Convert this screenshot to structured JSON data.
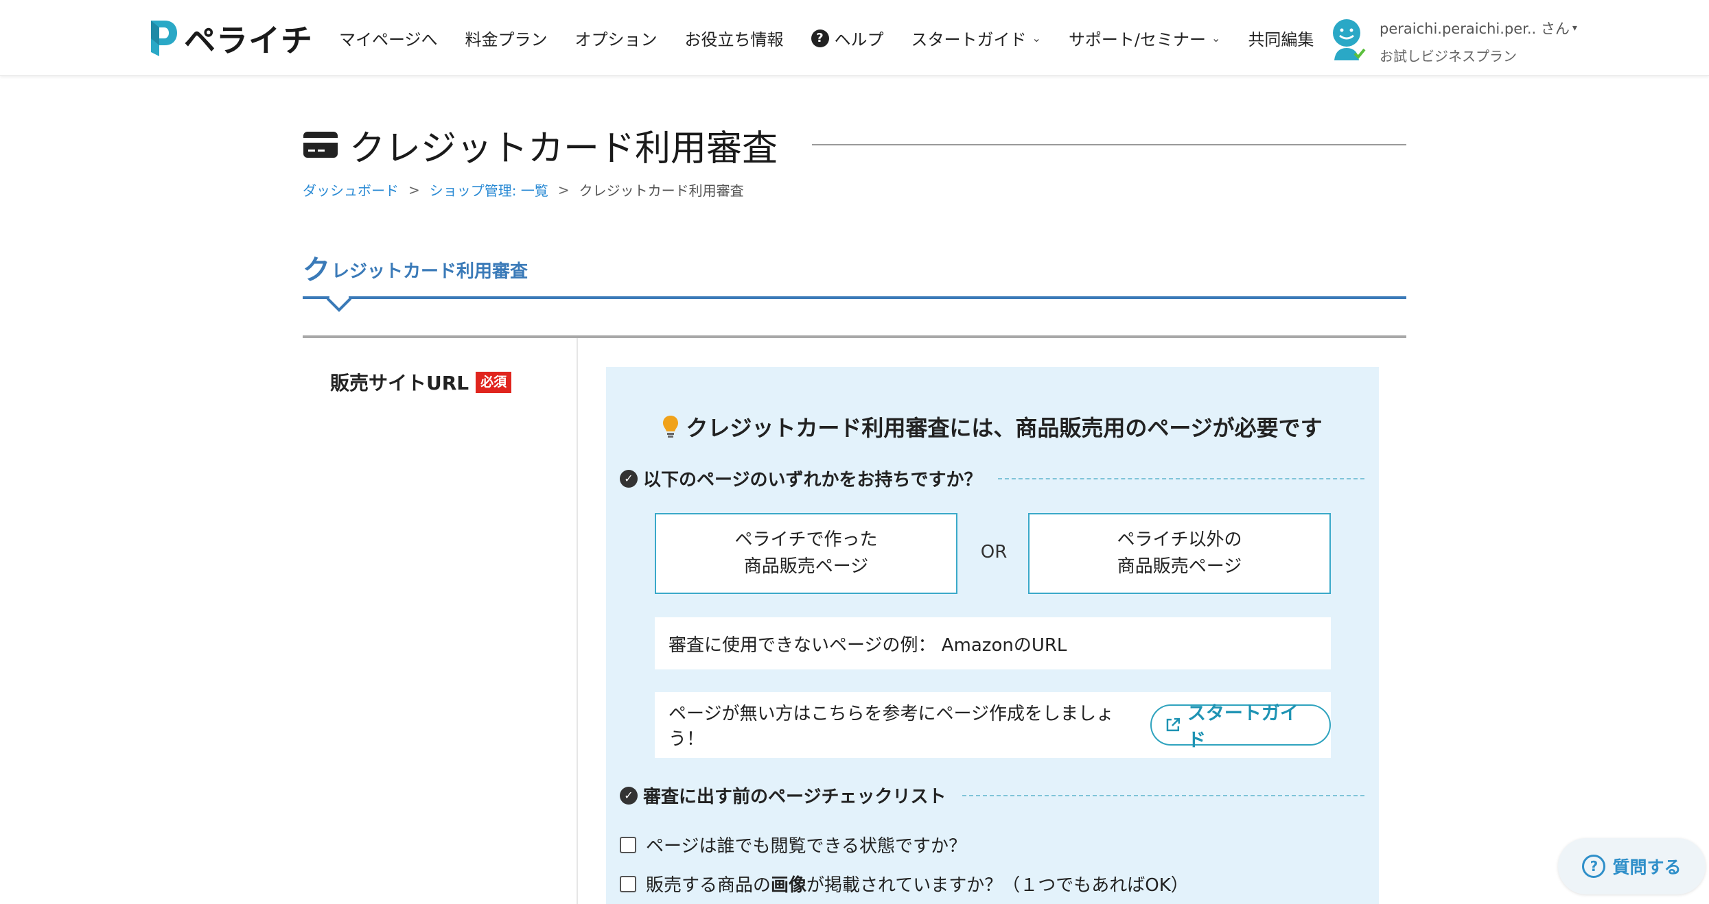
{
  "header": {
    "logo_text": "ペライチ",
    "nav": [
      {
        "label": "マイページへ"
      },
      {
        "label": "料金プラン"
      },
      {
        "label": "オプション"
      },
      {
        "label": "お役立ち情報"
      },
      {
        "label": "ヘルプ",
        "icon": "question-circle-icon"
      },
      {
        "label": "スタートガイド",
        "icon": "chevron-down-icon"
      },
      {
        "label": "サポート/セミナー",
        "icon": "chevron-down-icon"
      },
      {
        "label": "共同編集"
      }
    ],
    "user": {
      "name": "peraichi.peraichi.per.. さん",
      "plan": "お試しビジネスプラン"
    }
  },
  "page": {
    "title": "クレジットカード利用審査",
    "breadcrumb": [
      {
        "label": "ダッシュボード",
        "link": true
      },
      {
        "label": "ショップ管理: 一覧",
        "link": true
      },
      {
        "label": "クレジットカード利用審査",
        "link": false
      }
    ],
    "breadcrumb_sep": ">",
    "section_first_char": "ク",
    "section_rest": "レジットカード利用審査"
  },
  "form": {
    "field_label": "販売サイトURL",
    "required_badge": "必須",
    "panel_title": "クレジットカード利用審査には、商品販売用のページが必要です",
    "question1": "以下のページのいずれかをお持ちですか？",
    "option1_line1": "ペライチで作った",
    "option1_line2": "商品販売ページ",
    "or_text": "OR",
    "option2_line1": "ペライチ以外の",
    "option2_line2": "商品販売ページ",
    "not_usable": "審査に使用できないページの例： AmazonのURL",
    "no_page_text": "ページが無い方はこちらを参考にページ作成をしましょう！",
    "start_guide_button": "スタートガイド",
    "question2": "審査に出す前のページチェックリスト",
    "check1": "ページは誰でも閲覧できる状態ですか？",
    "check2_before": "販売する商品の",
    "check2_bold": "画像",
    "check2_after": "が掲載されていますか？（１つでもあればOK）"
  },
  "ask_button": "質問する",
  "colors": {
    "brand_teal": "#2aa8c6",
    "section_blue": "#3a7ab8",
    "required_red": "#e0251e",
    "panel_bg": "#e3f2fb",
    "link_blue": "#2a8ad4"
  }
}
